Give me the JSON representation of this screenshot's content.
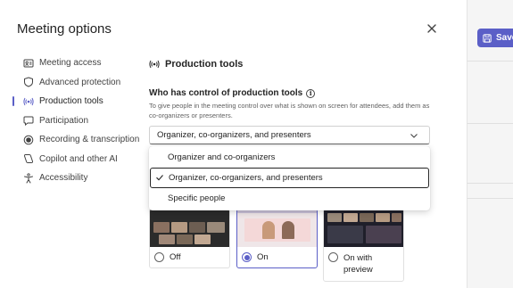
{
  "background": {
    "save_label": "Save"
  },
  "dialog": {
    "title": "Meeting options",
    "close_icon": "close-icon"
  },
  "nav": {
    "items": [
      {
        "label": "Meeting access",
        "icon": "id-card-icon"
      },
      {
        "label": "Advanced protection",
        "icon": "shield-icon"
      },
      {
        "label": "Production tools",
        "icon": "broadcast-icon",
        "active": true
      },
      {
        "label": "Participation",
        "icon": "chat-icon"
      },
      {
        "label": "Recording & transcription",
        "icon": "record-icon"
      },
      {
        "label": "Copilot and other AI",
        "icon": "copilot-icon"
      },
      {
        "label": "Accessibility",
        "icon": "accessibility-icon"
      }
    ]
  },
  "section": {
    "title": "Production tools",
    "question": "Who has control of production tools",
    "description": "To give people in the meeting control over what is shown on screen for attendees, add them as co-organizers or presenters.",
    "selected_value": "Organizer, co-organizers, and presenters",
    "options": [
      {
        "label": "Organizer and co-organizers",
        "selected": false
      },
      {
        "label": "Organizer, co-organizers, and presenters",
        "selected": true
      },
      {
        "label": "Specific people",
        "selected": false
      }
    ]
  },
  "view_cards": [
    {
      "label": "Off",
      "selected": false
    },
    {
      "label": "On",
      "selected": true
    },
    {
      "label": "On with preview",
      "selected": false
    }
  ],
  "colors": {
    "accent": "#5b5fc7",
    "text": "#242424",
    "muted": "#616161"
  }
}
